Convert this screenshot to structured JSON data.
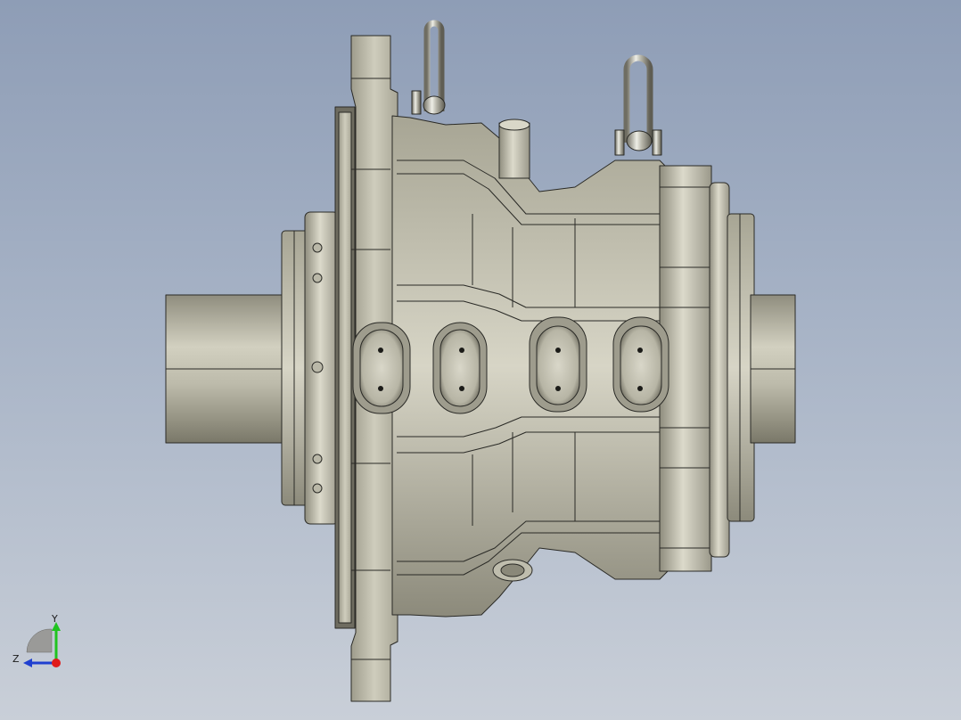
{
  "viewport": {
    "background_top": "#8e9db6",
    "background_bottom": "#c9cfd8",
    "model_color": "#c9c7b6",
    "edge_color": "#2a2a26"
  },
  "triad": {
    "x_label": "",
    "y_label": "Y",
    "z_label": "Z",
    "y_color": "#1fc31f",
    "z_color": "#1f3fd0",
    "origin_color": "#e01a1a"
  }
}
